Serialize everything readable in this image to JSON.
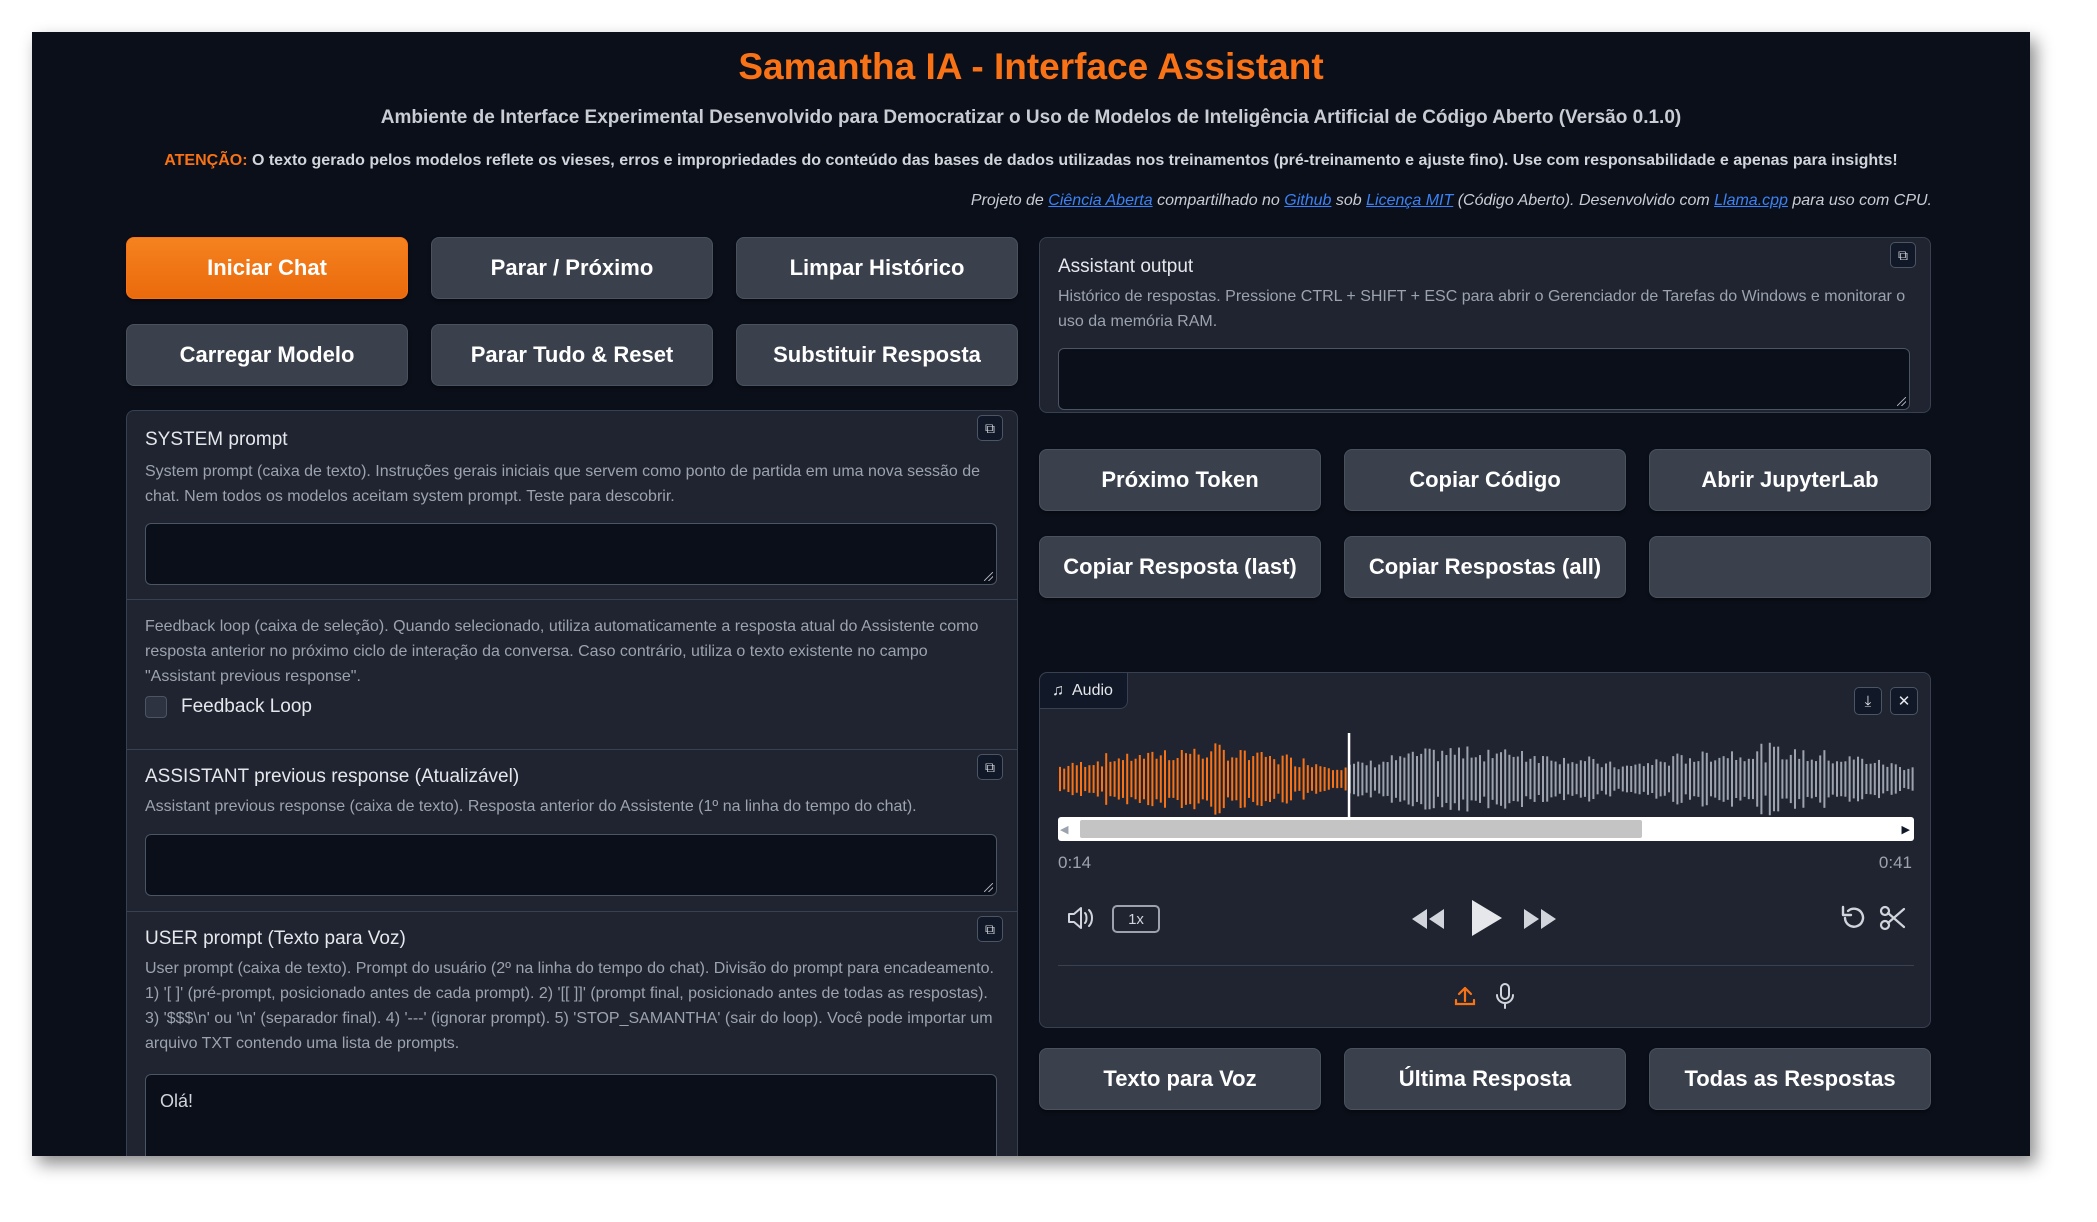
{
  "header": {
    "title": "Samantha IA - Interface Assistant",
    "subtitle": "Ambiente de Interface Experimental Desenvolvido para Democratizar o Uso de Modelos de Inteligência Artificial de Código Aberto (Versão 0.1.0)",
    "warning_label": "ATENÇÃO:",
    "warning_text": " O texto gerado pelos modelos reflete os vieses, erros e impropriedades do conteúdo das bases de dados utilizadas nos treinamentos (pré-treinamento e ajuste fino). Use com responsabilidade e apenas para insights!",
    "credits": {
      "t1": "Projeto de ",
      "link1": "Ciência Aberta",
      "t2": " compartilhado no ",
      "link2": "Github",
      "t3": " sob ",
      "link3": "Licença MIT",
      "t4": " (Código Aberto). Desenvolvido com ",
      "link4": "Llama.cpp",
      "t5": " para uso com CPU."
    }
  },
  "left_buttons": {
    "iniciar": "Iniciar Chat",
    "parar": "Parar / Próximo",
    "limpar": "Limpar Histórico",
    "carregar": "Carregar Modelo",
    "parar_tudo": "Parar Tudo & Reset",
    "substituir": "Substituir Resposta"
  },
  "system_prompt": {
    "label": "SYSTEM prompt",
    "info": "System prompt (caixa de texto). Instruções gerais iniciais que servem como ponto de partida em uma nova sessão de chat. Nem todos os modelos aceitam system prompt. Teste para descobrir.",
    "value": ""
  },
  "feedback": {
    "info": "Feedback loop (caixa de seleção). Quando selecionado, utiliza automaticamente a resposta atual do Assistente como resposta anterior no próximo ciclo de interação da conversa. Caso contrário, utiliza o texto existente no campo \"Assistant previous response\".",
    "checkbox_label": "Feedback Loop",
    "checked": false
  },
  "assistant_prev": {
    "label": "ASSISTANT previous response (Atualizável)",
    "info": "Assistant previous response (caixa de texto). Resposta anterior do Assistente (1º na linha do tempo do chat).",
    "value": ""
  },
  "user_prompt": {
    "label": "USER prompt (Texto para Voz)",
    "info": "User prompt (caixa de texto). Prompt do usuário (2º na linha do tempo do chat). Divisão do prompt para encadeamento. 1) '[ ]' (pré-prompt, posicionado antes de cada prompt). 2) '[[ ]]' (prompt final, posicionado antes de todas as respostas). 3) '$$$\\n' ou '\\n' (separador final). 4) '---' (ignorar prompt). 5) 'STOP_SAMANTHA' (sair do loop). Você pode importar um arquivo TXT contendo uma lista de prompts.",
    "value": "Olá!"
  },
  "assistant_output": {
    "label": "Assistant output",
    "info": "Histórico de respostas. Pressione CTRL + SHIFT + ESC para abrir o Gerenciador de Tarefas do Windows e monitorar o uso da memória RAM.",
    "value": ""
  },
  "right_buttons": {
    "proximo_token": "Próximo Token",
    "copiar_codigo": "Copiar Código",
    "abrir_jupyter": "Abrir JupyterLab",
    "copiar_last": "Copiar Resposta (last)",
    "copiar_all": "Copiar Respostas (all)",
    "empty": ""
  },
  "audio": {
    "label": "Audio",
    "current_time": "0:14",
    "duration": "0:41",
    "played_fraction": 0.34,
    "speed": "1x"
  },
  "bottom_buttons": {
    "texto_voz": "Texto para Voz",
    "ultima": "Última Resposta",
    "todas": "Todas as Respostas"
  },
  "colors": {
    "accent": "#f97316",
    "background": "#0b0f19",
    "panel": "#1f2430",
    "button": "#3a414d",
    "link": "#3b82f6"
  }
}
